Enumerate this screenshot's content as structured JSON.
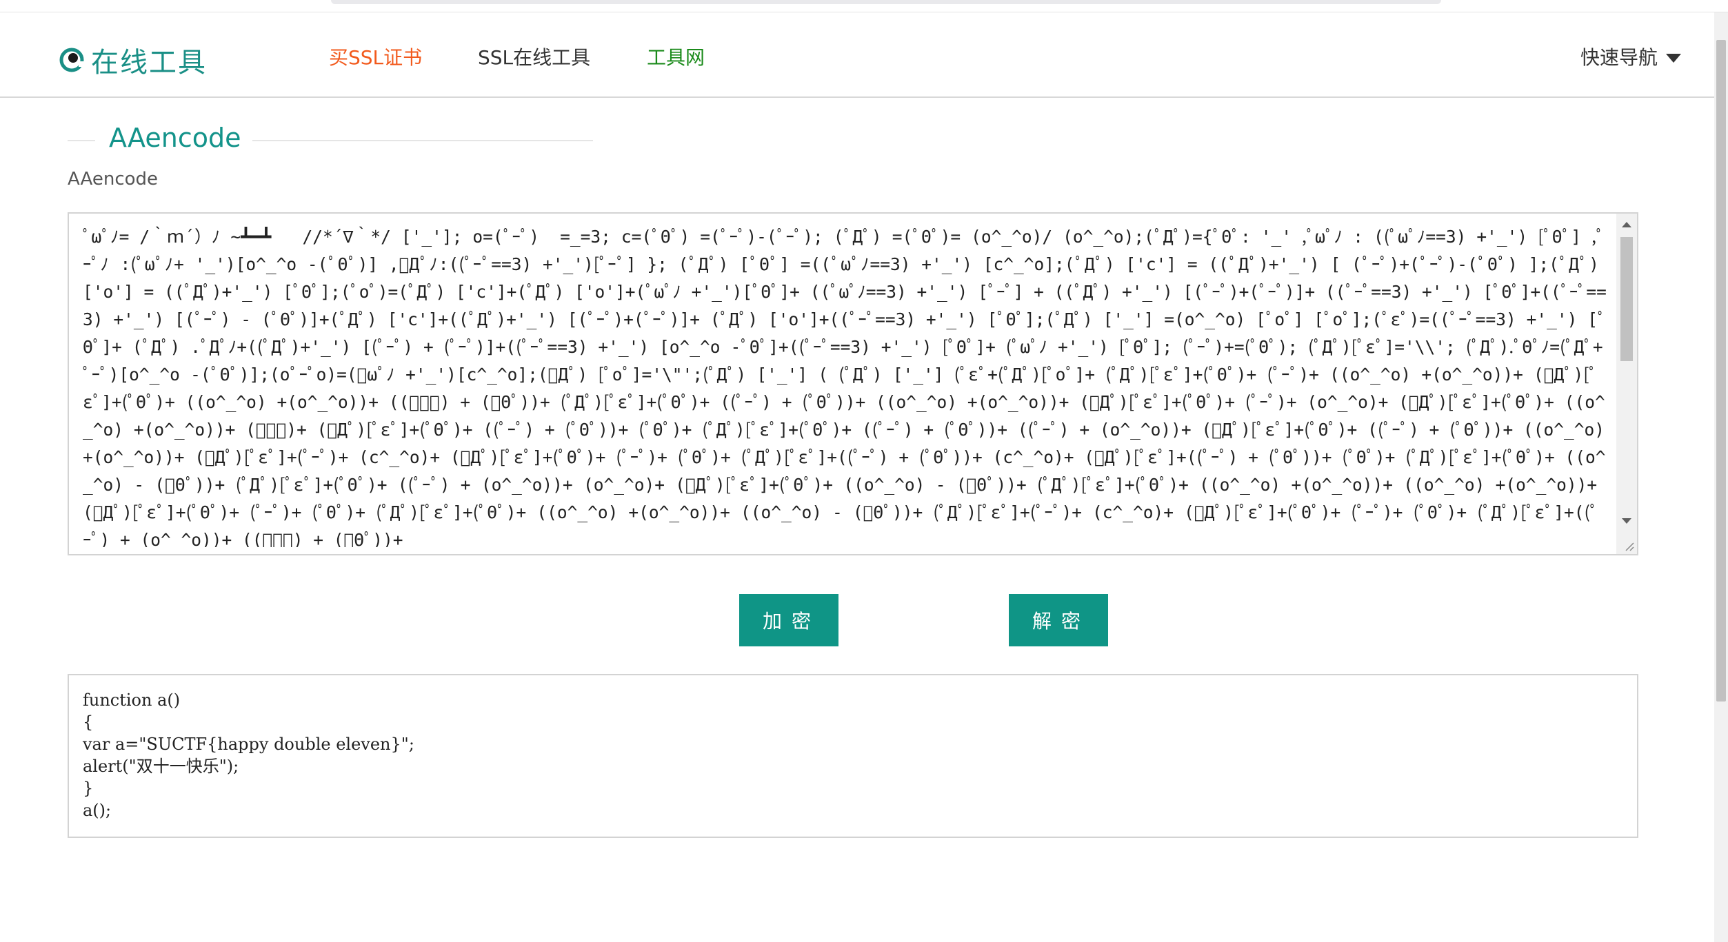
{
  "header": {
    "logo_text": "在线工具",
    "nav": {
      "buy_ssl": "买SSL证书",
      "ssl_tools": "SSL在线工具",
      "tool_net": "工具网",
      "quick_nav": "快速导航"
    }
  },
  "colors": {
    "accent": "#13938a",
    "button": "#0f9586",
    "buy_link": "#f25a1d",
    "tool_net_link": "#1a8a1a"
  },
  "icons": {
    "logo": "logo-icon",
    "quick_nav": "caret-down-icon"
  },
  "main": {
    "section_title": "AAencode",
    "field_label": "AAencode",
    "input_value": "ﾟωﾟﾉ= /｀ｍ´）ﾉ ~┻━┻   //*´∇｀*/ ['_']; o=(ﾟｰﾟ)  =_=3; c=(ﾟΘﾟ) =(ﾟｰﾟ)-(ﾟｰﾟ); (ﾟДﾟ) =(ﾟΘﾟ)= (o^_^o)/ (o^_^o);(ﾟДﾟ)={ﾟΘﾟ: '_' ,ﾟωﾟﾉ : ((ﾟωﾟﾉ==3) +'_') [ﾟΘﾟ] ,ﾟｰﾟﾉ :(ﾟωﾟﾉ+ '_')[o^_^o -(ﾟΘﾟ)] ,ﾟДﾟﾉ:((ﾟｰﾟ==3) +'_')[ﾟｰﾟ] }; (ﾟДﾟ) [ﾟΘﾟ] =((ﾟωﾟﾉ==3) +'_') [c^_^o];(ﾟДﾟ) ['c'] = ((ﾟДﾟ)+'_') [ (ﾟｰﾟ)+(ﾟｰﾟ)-(ﾟΘﾟ) ];(ﾟДﾟ) ['o'] = ((ﾟДﾟ)+'_') [ﾟΘﾟ];(ﾟoﾟ)=(ﾟДﾟ) ['c']+(ﾟДﾟ) ['o']+(ﾟωﾟﾉ +'_')[ﾟΘﾟ]+ ((ﾟωﾟﾉ==3) +'_') [ﾟｰﾟ] + ((ﾟДﾟ) +'_') [(ﾟｰﾟ)+(ﾟｰﾟ)]+ ((ﾟｰﾟ==3) +'_') [ﾟΘﾟ]+((ﾟｰﾟ==3) +'_') [(ﾟｰﾟ) - (ﾟΘﾟ)]+(ﾟДﾟ) ['c']+((ﾟДﾟ)+'_') [(ﾟｰﾟ)+(ﾟｰﾟ)]+ (ﾟДﾟ) ['o']+((ﾟｰﾟ==3) +'_') [ﾟΘﾟ];(ﾟДﾟ) ['_'] =(o^_^o) [ﾟoﾟ] [ﾟoﾟ];(ﾟεﾟ)=((ﾟｰﾟ==3) +'_') [ﾟΘﾟ]+ (ﾟДﾟ) .ﾟДﾟﾉ+((ﾟДﾟ)+'_') [(ﾟｰﾟ) + (ﾟｰﾟ)]+((ﾟｰﾟ==3) +'_') [o^_^o -ﾟΘﾟ]+((ﾟｰﾟ==3) +'_') [ﾟΘﾟ]+ (ﾟωﾟﾉ +'_') [ﾟΘﾟ]; (ﾟｰﾟ)+=(ﾟΘﾟ); (ﾟДﾟ)[ﾟεﾟ]='\\\\'; (ﾟДﾟ).ﾟΘﾟﾉ=(ﾟДﾟ+ ﾟｰﾟ)[o^_^o -(ﾟΘﾟ)];(oﾟｰﾟo)=(ﾟωﾟﾉ +'_')[c^_^o];(ﾟДﾟ) [ﾟoﾟ]='\\\"';(ﾟДﾟ) ['_'] ( (ﾟДﾟ) ['_'] (ﾟεﾟ+(ﾟДﾟ)[ﾟoﾟ]+ (ﾟДﾟ)[ﾟεﾟ]+(ﾟΘﾟ)+ (ﾟｰﾟ)+ ((o^_^o) +(o^_^o))+ (ﾟДﾟ)[ﾟεﾟ]+(ﾟΘﾟ)+ ((o^_^o) +(o^_^o))+ ((ﾟｰﾟ) + (ﾟΘﾟ))+ (ﾟДﾟ)[ﾟεﾟ]+(ﾟΘﾟ)+ ((ﾟｰﾟ) + (ﾟΘﾟ))+ ((o^_^o) +(o^_^o))+ (ﾟДﾟ)[ﾟεﾟ]+(ﾟΘﾟ)+ (ﾟｰﾟ)+ (o^_^o)+ (ﾟДﾟ)[ﾟεﾟ]+(ﾟΘﾟ)+ ((o^_^o) +(o^_^o))+ (ﾟｰﾟ)+ (ﾟДﾟ)[ﾟεﾟ]+(ﾟΘﾟ)+ ((ﾟｰﾟ) + (ﾟΘﾟ))+ (ﾟΘﾟ)+ (ﾟДﾟ)[ﾟεﾟ]+(ﾟΘﾟ)+ ((ﾟｰﾟ) + (ﾟΘﾟ))+ ((ﾟｰﾟ) + (o^_^o))+ (ﾟДﾟ)[ﾟεﾟ]+(ﾟΘﾟ)+ ((ﾟｰﾟ) + (ﾟΘﾟ))+ ((o^_^o) +(o^_^o))+ (ﾟДﾟ)[ﾟεﾟ]+(ﾟｰﾟ)+ (c^_^o)+ (ﾟДﾟ)[ﾟεﾟ]+(ﾟΘﾟ)+ (ﾟｰﾟ)+ (ﾟΘﾟ)+ (ﾟДﾟ)[ﾟεﾟ]+((ﾟｰﾟ) + (ﾟΘﾟ))+ (c^_^o)+ (ﾟДﾟ)[ﾟεﾟ]+((ﾟｰﾟ) + (ﾟΘﾟ))+ (ﾟΘﾟ)+ (ﾟДﾟ)[ﾟεﾟ]+(ﾟΘﾟ)+ ((o^_^o) - (ﾟΘﾟ))+ (ﾟДﾟ)[ﾟεﾟ]+(ﾟΘﾟ)+ ((ﾟｰﾟ) + (o^_^o))+ (o^_^o)+ (ﾟДﾟ)[ﾟεﾟ]+(ﾟΘﾟ)+ ((o^_^o) - (ﾟΘﾟ))+ (ﾟДﾟ)[ﾟεﾟ]+(ﾟΘﾟ)+ ((o^_^o) +(o^_^o))+ ((o^_^o) +(o^_^o))+ (ﾟДﾟ)[ﾟεﾟ]+(ﾟΘﾟ)+ (ﾟｰﾟ)+ (ﾟΘﾟ)+ (ﾟДﾟ)[ﾟεﾟ]+(ﾟΘﾟ)+ ((o^_^o) +(o^_^o))+ ((o^_^o) - (ﾟΘﾟ))+ (ﾟДﾟ)[ﾟεﾟ]+(ﾟｰﾟ)+ (c^_^o)+ (ﾟДﾟ)[ﾟεﾟ]+(ﾟΘﾟ)+ (ﾟｰﾟ)+ (ﾟΘﾟ)+ (ﾟДﾟ)[ﾟεﾟ]+((ﾟｰﾟ) + (o^_^o))+ ((ﾟｰﾟ) + (ﾟΘﾟ))+",
    "output_lines": [
      "function a()",
      "{",
      "var a=\"SUCTF{happy double eleven}\";",
      "alert(\"双十一快乐\");",
      "}",
      "a();"
    ]
  },
  "buttons": {
    "encrypt": "加密",
    "decrypt": "解密"
  }
}
